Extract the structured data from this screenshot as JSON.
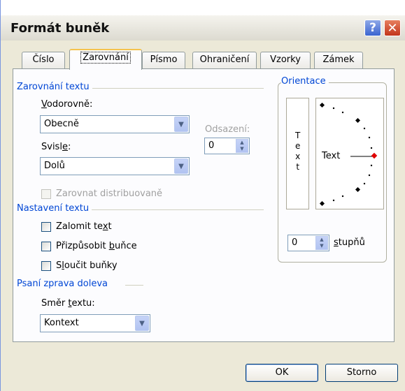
{
  "window": {
    "title": "Formát buněk"
  },
  "tabs": [
    "Číslo",
    "Zarovnání",
    "Písmo",
    "Ohraničení",
    "Vzorky",
    "Zámek"
  ],
  "alignment": {
    "group_title": "Zarovnání textu",
    "horizontal_label": "Vodorovně:",
    "horizontal_value": "Obecně",
    "vertical_label": "Svisle:",
    "vertical_value": "Dolů",
    "indent_label": "Odsazení:",
    "indent_value": "0",
    "distributed_label": "Zarovnat distribuovaně"
  },
  "text_control": {
    "group_title": "Nastavení textu",
    "wrap_label": "Zalomit text",
    "shrink_label": "Přizpůsobit buňce",
    "merge_label": "Sloučit buňky"
  },
  "rtl": {
    "group_title": "Psaní zprava doleva",
    "direction_label": "Směr textu:",
    "direction_value": "Kontext"
  },
  "orientation": {
    "group_title": "Orientace",
    "vertical_text": [
      "T",
      "e",
      "x",
      "t"
    ],
    "dial_text": "Text",
    "degrees_value": "0",
    "degrees_label": "stupňů"
  },
  "buttons": {
    "ok": "OK",
    "cancel": "Storno"
  },
  "colors": {
    "group_title": "#0046d5",
    "dial_marker": "#e00000",
    "dialog_bg": "#ece9d8"
  }
}
